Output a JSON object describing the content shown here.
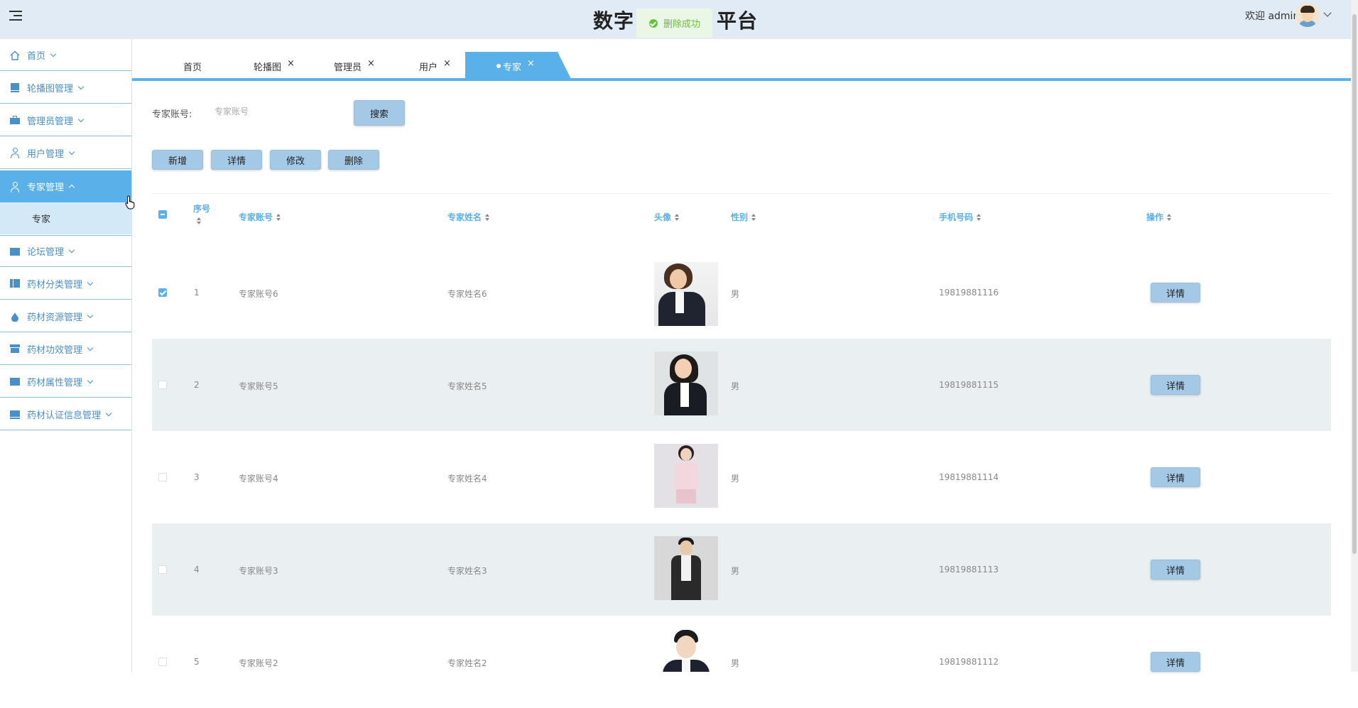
{
  "header": {
    "title": "数字　　　　平台",
    "welcome": "欢迎 admin",
    "toast": "删除成功"
  },
  "sidebar": {
    "items": [
      {
        "label": "首页",
        "icon": "home-icon"
      },
      {
        "label": "轮播图管理",
        "icon": "image-icon"
      },
      {
        "label": "管理员管理",
        "icon": "briefcase-icon"
      },
      {
        "label": "用户管理",
        "icon": "user-icon"
      },
      {
        "label": "专家管理",
        "icon": "user-icon",
        "active": true
      },
      {
        "label": "论坛管理",
        "icon": "folder-icon"
      },
      {
        "label": "药材分类管理",
        "icon": "book-icon"
      },
      {
        "label": "药材资源管理",
        "icon": "drop-icon"
      },
      {
        "label": "药材功效管理",
        "icon": "box-icon"
      },
      {
        "label": "药材属性管理",
        "icon": "doc-icon"
      },
      {
        "label": "药材认证信息管理",
        "icon": "monitor-icon"
      }
    ],
    "sub_item": "专家"
  },
  "tabs": [
    {
      "label": "首页"
    },
    {
      "label": "轮播图"
    },
    {
      "label": "管理员"
    },
    {
      "label": "用户"
    },
    {
      "label": "专家",
      "active": true
    }
  ],
  "tab_close": "×",
  "search": {
    "label": "专家账号:",
    "placeholder": "专家账号",
    "button": "搜索"
  },
  "actions": {
    "add": "新增",
    "detail": "详情",
    "edit": "修改",
    "delete": "删除"
  },
  "table": {
    "columns": [
      "序号",
      "专家账号",
      "专家姓名",
      "头像",
      "性别",
      "手机号码",
      "操作"
    ],
    "rows": [
      {
        "index": "1",
        "account": "专家账号6",
        "name": "专家姓名6",
        "gender": "男",
        "phone": "19819881116",
        "checked": true
      },
      {
        "index": "2",
        "account": "专家账号5",
        "name": "专家姓名5",
        "gender": "男",
        "phone": "19819881115",
        "checked": false
      },
      {
        "index": "3",
        "account": "专家账号4",
        "name": "专家姓名4",
        "gender": "男",
        "phone": "19819881114",
        "checked": false
      },
      {
        "index": "4",
        "account": "专家账号3",
        "name": "专家姓名3",
        "gender": "男",
        "phone": "19819881113",
        "checked": false
      },
      {
        "index": "5",
        "account": "专家账号2",
        "name": "专家姓名2",
        "gender": "男",
        "phone": "19819881112",
        "checked": false
      }
    ],
    "row_action": "详情"
  },
  "colors": {
    "accent": "#5ab0e8",
    "header_bg": "#e1ebf5",
    "button_bg": "#a3c9e6",
    "stripe": "#eaf0f2",
    "success": "#67c23a"
  }
}
